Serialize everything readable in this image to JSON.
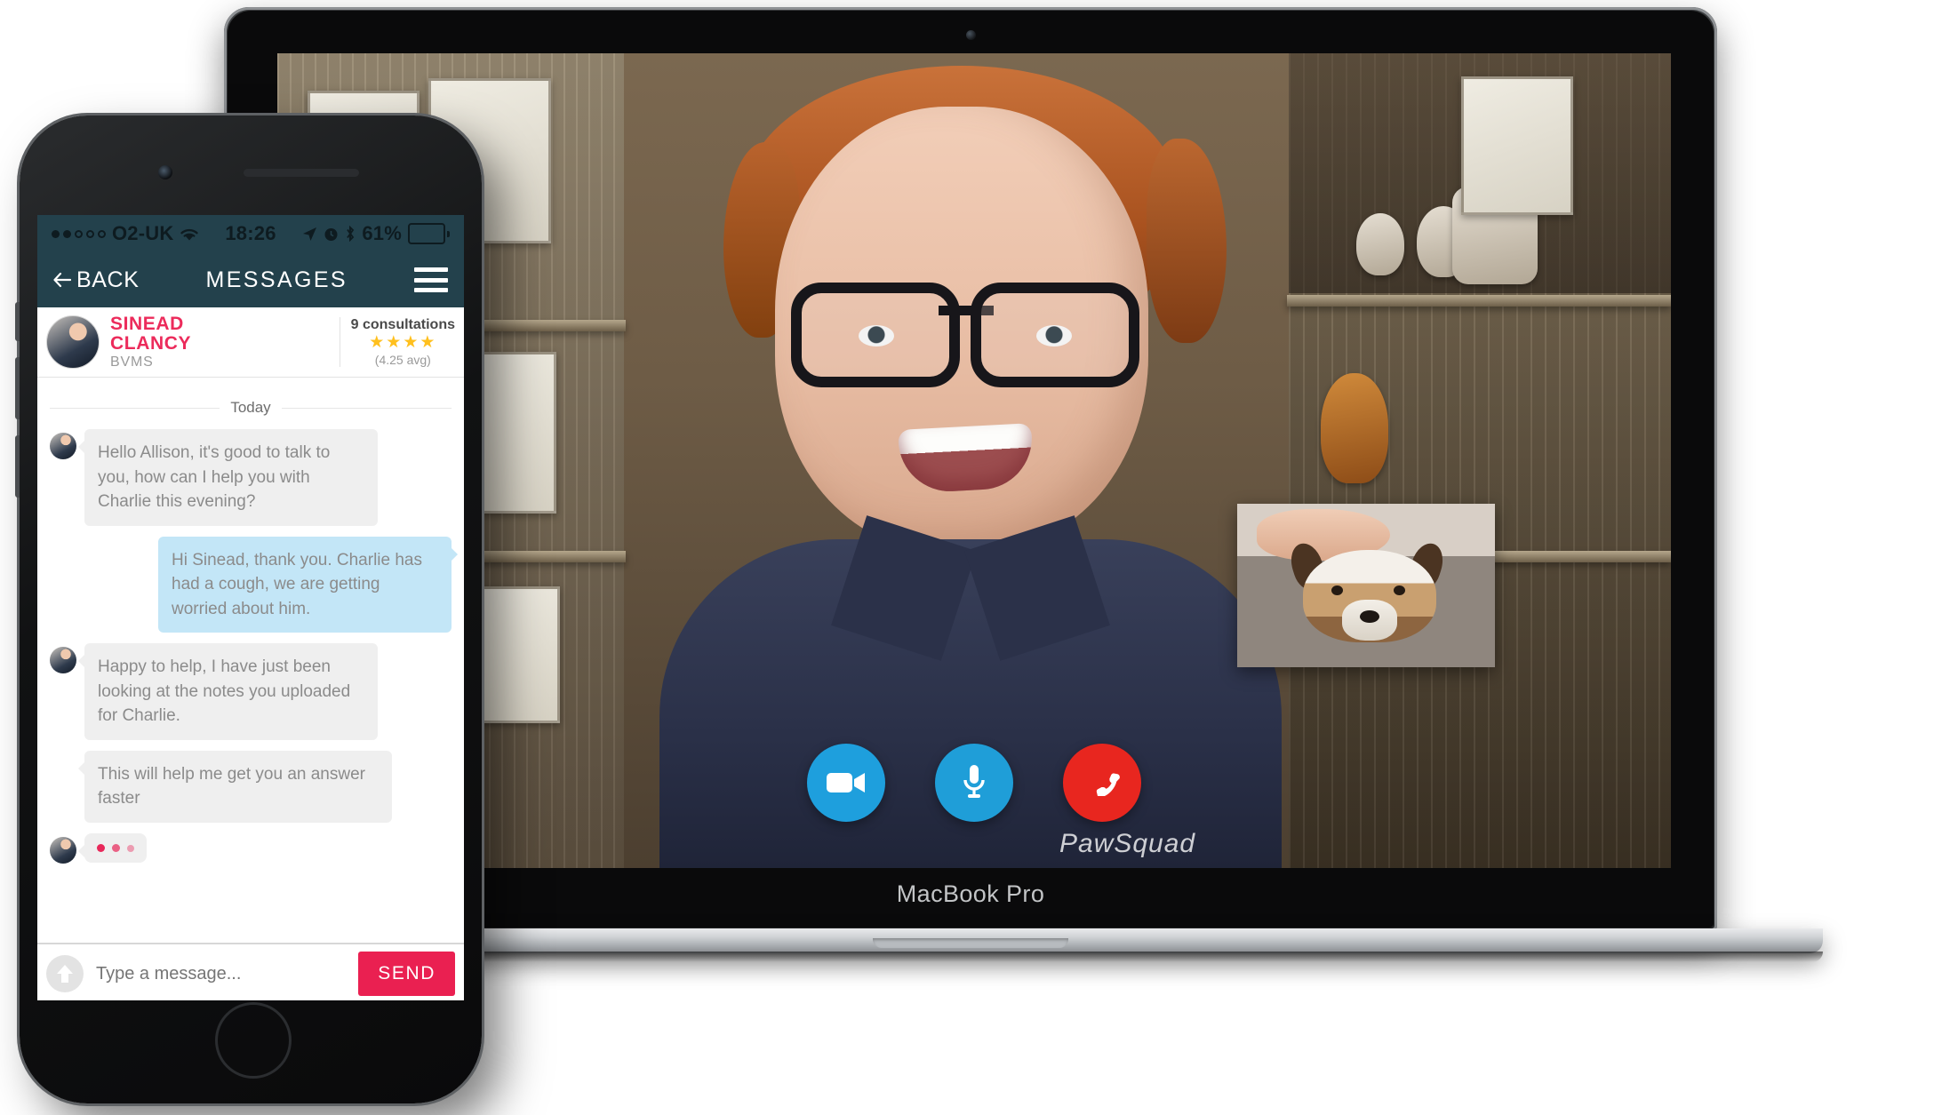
{
  "laptop": {
    "brand_label": "MacBook Pro",
    "device_name": "macbook-pro"
  },
  "videocall": {
    "controls": [
      {
        "name": "video-toggle-button",
        "icon": "video-camera-icon",
        "color": "#1e9fdd"
      },
      {
        "name": "mute-toggle-button",
        "icon": "microphone-icon",
        "color": "#1f9ed8"
      },
      {
        "name": "end-call-button",
        "icon": "phone-hangup-icon",
        "color": "#e8261f"
      }
    ],
    "self_view_label": "dog-self-view",
    "remote_participant": "Sinead Clancy",
    "shirt_logo_text": "PawSquad"
  },
  "phone": {
    "statusbar": {
      "carrier": "O2-UK",
      "signal_filled": 2,
      "signal_total": 5,
      "wifi_icon": "wifi-icon",
      "time": "18:26",
      "location_icon": "location-arrow-icon",
      "alarm_icon": "alarm-clock-icon",
      "bluetooth_icon": "bluetooth-icon",
      "battery_percent": "61%",
      "battery_level": 61
    },
    "navbar": {
      "back_label": "BACK",
      "back_icon": "arrow-left-icon",
      "title": "MESSAGES",
      "menu_icon": "hamburger-menu-icon"
    },
    "vet_card": {
      "avatar": "vet-avatar",
      "first_name": "SINEAD",
      "last_name": "CLANCY",
      "qualification": "BVMS",
      "consultations": "9 consultations",
      "stars": "★★★★",
      "stars_filled": 4,
      "average": "(4.25 avg)",
      "name_color": "#ec2b5b",
      "star_color": "#ffc01e"
    },
    "chat": {
      "day_divider": "Today",
      "messages": [
        {
          "from": "them",
          "text": "Hello Allison, it's good to talk to you, how can I help you with Charlie this evening?"
        },
        {
          "from": "me",
          "text": "Hi Sinead, thank you. Charlie has had a cough, we are getting worried about him."
        },
        {
          "from": "them",
          "text": "Happy to help, I have just been looking at the notes you uploaded for Charlie."
        },
        {
          "from": "them",
          "text": "This will help me get you an answer faster"
        }
      ],
      "typing_indicator": {
        "visible": true,
        "dots": 3,
        "color": "#e8285a"
      }
    },
    "composer": {
      "upload_icon": "upload-arrow-icon",
      "placeholder": "Type a message...",
      "value": "",
      "send_label": "SEND",
      "send_color": "#ea2051"
    }
  }
}
